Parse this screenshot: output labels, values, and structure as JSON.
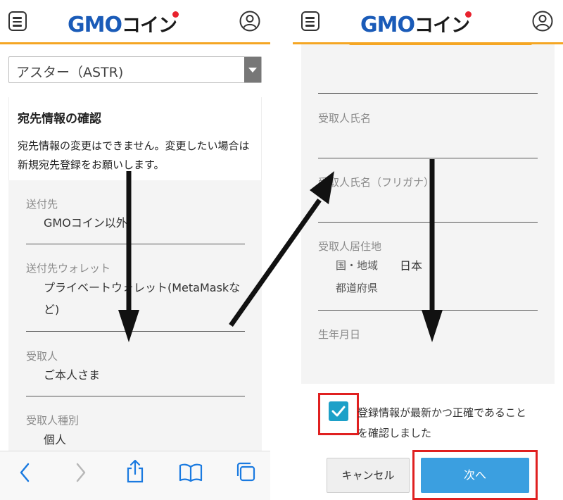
{
  "app": {
    "logo_gmo": "GMO",
    "logo_coin": "コイン",
    "brand_color": "#1a5bb8",
    "accent_color": "#f5a623"
  },
  "left": {
    "currency_select": "アスター（ASTR)",
    "card_title": "宛先情報の確認",
    "card_desc": "宛先情報の変更はできません。変更したい場合は新規宛先登録をお願いします。",
    "fields": [
      {
        "label": "送付先",
        "value": "GMOコイン以外"
      },
      {
        "label": "送付先ウォレット",
        "value": "プライベートウォレット(MetaMaskなど)"
      },
      {
        "label": "受取人",
        "value": "ご本人さま"
      },
      {
        "label": "受取人種別",
        "value": "個人"
      }
    ]
  },
  "right": {
    "fields": [
      {
        "label": "受取人氏名"
      },
      {
        "label": "受取人氏名（フリガナ）"
      },
      {
        "label": "受取人居住地"
      }
    ],
    "country_label": "国・地域",
    "country_value": "日本",
    "prefecture_label": "都道府県",
    "birthdate_label": "生年月日",
    "confirm_checked": true,
    "confirm_text": "登録情報が最新かつ正確であることを確認しました",
    "cancel_label": "キャンセル",
    "next_label": "次へ"
  },
  "browser_toolbar": {
    "icons": [
      "back-icon",
      "forward-icon",
      "share-icon",
      "bookmarks-icon",
      "tabs-icon"
    ]
  }
}
